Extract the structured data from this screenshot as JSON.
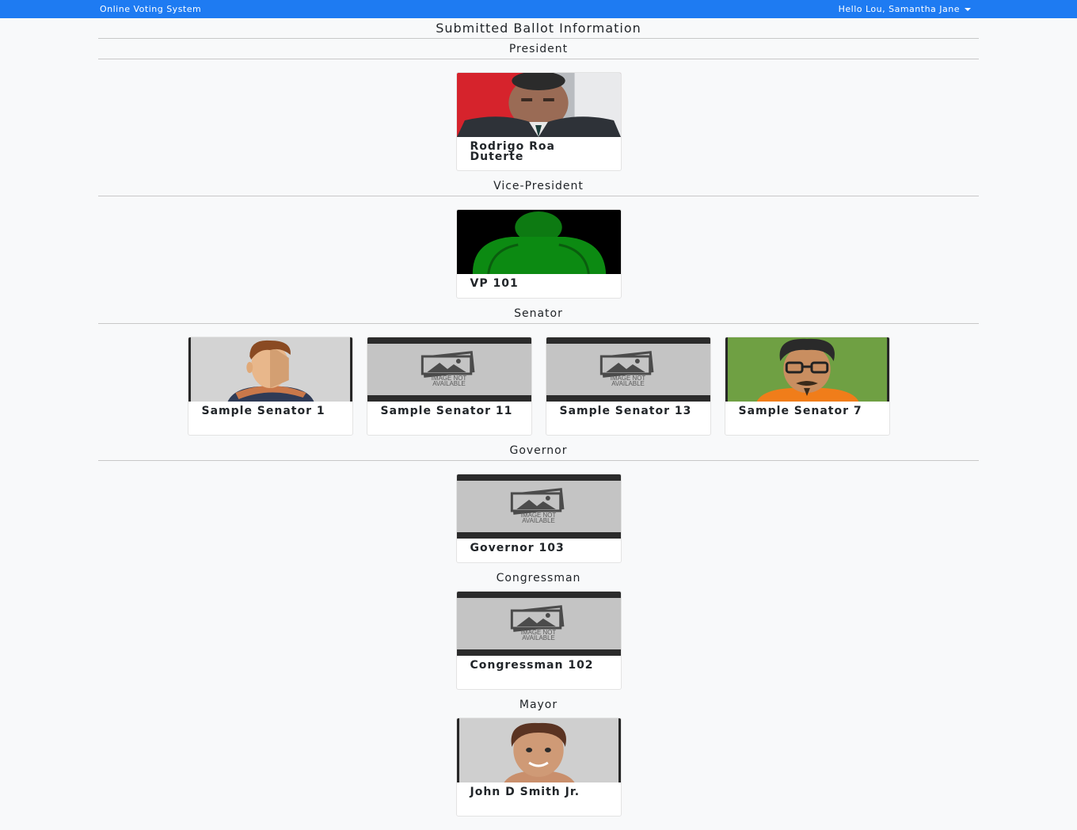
{
  "navbar": {
    "brand": "Online Voting System",
    "user_greeting": "Hello Lou, Samantha Jane"
  },
  "page_title": "Submitted Ballot Information",
  "sections": [
    {
      "title": "President",
      "candidates": [
        {
          "name": "Rodrigo Roa Duterte",
          "photo": "photo-duterte"
        }
      ]
    },
    {
      "title": "Vice-President",
      "candidates": [
        {
          "name": "VP 101",
          "photo": "green-silhouette"
        }
      ]
    },
    {
      "title": "Senator",
      "candidates": [
        {
          "name": "Sample Senator 1",
          "photo": "cartoon-man-scarf"
        },
        {
          "name": "Sample Senator 11",
          "photo": "image-not-available"
        },
        {
          "name": "Sample Senator 13",
          "photo": "image-not-available"
        },
        {
          "name": "Sample Senator 7",
          "photo": "cartoon-man-glasses"
        }
      ]
    },
    {
      "title": "Governor",
      "candidates": [
        {
          "name": "Governor 103",
          "photo": "image-not-available"
        }
      ]
    },
    {
      "title": "Congressman",
      "candidates": [
        {
          "name": "Congressman 102",
          "photo": "image-not-available"
        }
      ]
    },
    {
      "title": "Mayor",
      "candidates": [
        {
          "name": "John D Smith Jr.",
          "photo": "cartoon-man-smile"
        }
      ]
    }
  ],
  "placeholder": {
    "line1": "IMAGE NOT",
    "line2": "AVAILABLE"
  },
  "colors": {
    "navbar": "#1e7bf2",
    "background": "#f8f9fa"
  }
}
